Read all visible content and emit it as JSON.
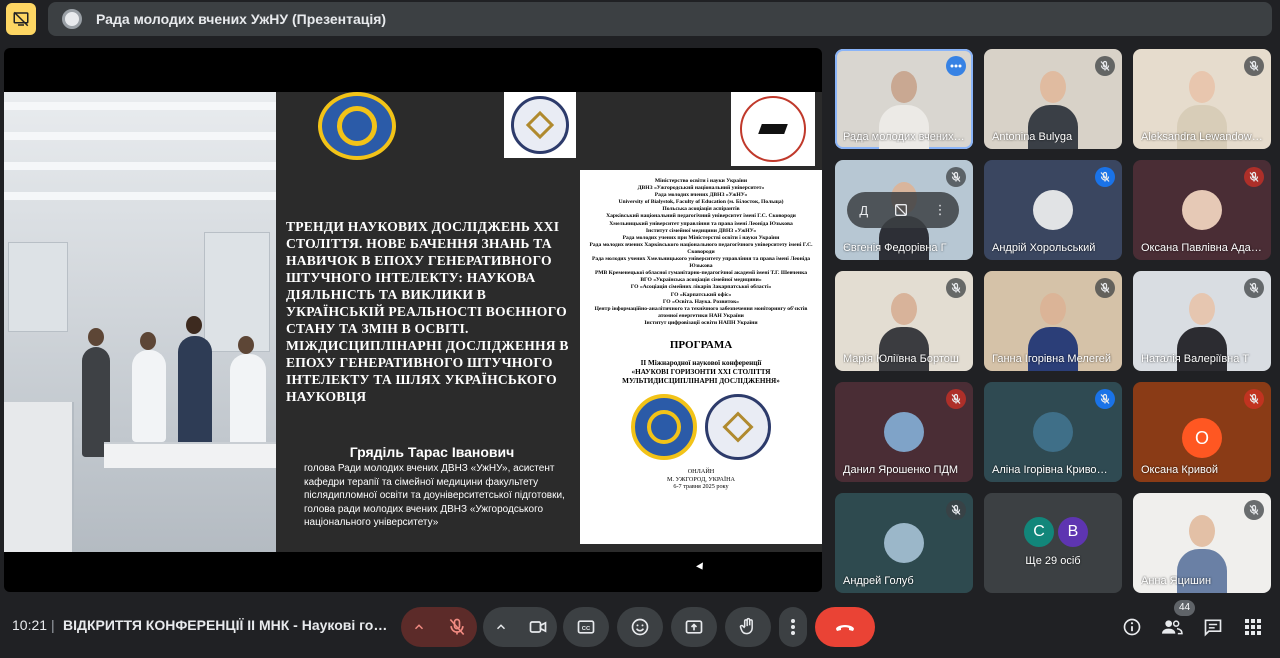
{
  "topbar": {
    "title": "Рада молодих вчених УжНУ (Презентація)"
  },
  "slide": {
    "title": "ТРЕНДИ НАУКОВИХ  ДОСЛІДЖЕНЬ XXI СТОЛІТТЯ. НОВЕ БАЧЕННЯ ЗНАНЬ ТА НАВИЧОК В ЕПОХУ ГЕНЕРАТИВНОГО ШТУЧНОГО ІНТЕЛЕКТУ: НАУКОВА ДІЯЛЬНІСТЬ ТА ВИКЛИКИ В УКРАЇНСЬКІЙ РЕАЛЬНОСТІ ВОЄННОГО СТАНУ ТА ЗМІН В ОСВІТІ. МІЖДИСЦИПЛІНАРНІ ДОСЛІДЖЕННЯ В ЕПОХУ ГЕНЕРАТИВНОГО ШТУЧНОГО ІНТЕЛЕКТУ ТА ШЛЯХ УКРАЇНСЬКОГО НАУКОВЦЯ",
    "speaker_name": "Гряділь Тарас Іванович",
    "speaker_desc": "голова Ради молодих вчених ДВНЗ «УжНУ», асистент кафедри терапії та сімейної медицини факультету післядипломної освіти та доуніверситетської підготовки, голова ради молодих вчених ДВНЗ «Ужгородського національного університету»",
    "program": {
      "orgs": [
        "Міністерство освіти і науки України",
        "ДВНЗ «Ужгородський національний університет»",
        "Рада молодих вчених ДВНЗ «УжНУ»",
        "University of Bialystok, Faculty of Education (м. Білосток, Польща)",
        "Польська асоціація аспірантів",
        "Харківський національний педагогічний університет імені Г.С. Сковороди",
        "Хмельницький університет управління та права імені Леоніда Юзькова",
        "Інститут сімейної медицини ДВНЗ «УжНУ»",
        "Рада молодих учених при Міністерстві освіти і науки України",
        "Рада молодих вчених Харківського національного педагогічного університету імені Г.С. Сковороди",
        "Рада молодих учених Хмельницького університету управління та права імені Леоніда Юзькова",
        "РМВ Кременецької обласної гуманітарно-педагогічної академії імені Т.Г. Шевченка",
        "ВГО «Українська асоціація сімейної медицини»",
        "ГО «Асоціація сімейних лікарів Закарпатської області»",
        "ГО «Карпатський офіс»",
        "ГО «Освіта. Наука. Розвиток»",
        "Центр інформаційно-аналітичного та технічного забезпечення моніторингу об'єктів атомної енергетики НАН України",
        "Інститут цифровізації освіти НАПН України"
      ],
      "heading": "ПРОГРАМА",
      "conf": [
        "ІІ Міжнародної наукової конференції",
        "«НАУКОВІ ГОРИЗОНТИ XXI СТОЛІТТЯ",
        "МУЛЬТИДИСЦИПЛІНАРНІ ДОСЛІДЖЕННЯ»"
      ],
      "footer": [
        "ОНЛАЙН",
        "М. УЖГОРОД, УКРАЇНА",
        "6-7 травня 2025 року"
      ]
    }
  },
  "participants": [
    {
      "name": "Рада молодих вчених УжНУ",
      "mic": "more",
      "skin": "#c9a892",
      "bg": "#d9d6d0",
      "shirt": "#eceae6"
    },
    {
      "name": "Antonina Bulyga",
      "mic": "muted",
      "skin": "#e0bba0",
      "bg": "#d8d2c8",
      "shirt": "#3a3f46"
    },
    {
      "name": "Aleksandra Lewandowska",
      "mic": "muted",
      "skin": "#e8c6ae",
      "bg": "#e6dccd",
      "shirt": "#d8cdb8"
    },
    {
      "name": "Євгенія Федорівна Г",
      "mic": "muted",
      "skin": "#d9b59c",
      "bg": "#b7c7d3",
      "shirt": "#2d2f36"
    },
    {
      "name": "Андрій Хорольський",
      "mic": "muted-blue",
      "avatar": "#e1e3e5"
    },
    {
      "name": "Оксана Павлівна Адамович",
      "mic": "muted-red",
      "avatar": "#e6c9b6"
    },
    {
      "name": "Марія Юліївна Бортош",
      "mic": "muted",
      "skin": "#d8b39a",
      "bg": "#e3ddd2",
      "shirt": "#3b3c40"
    },
    {
      "name": "Ганна Ігорівна Мелегей",
      "mic": "muted",
      "skin": "#dbb497",
      "bg": "#d5c2a8",
      "shirt": "#2b3e78"
    },
    {
      "name": "Наталія Валеріївна Т",
      "mic": "muted",
      "skin": "#e6c6b0",
      "bg": "#d9dde2",
      "shirt": "#2c2c31"
    },
    {
      "name": "Данил Ярошенко ПДМ",
      "mic": "muted-red",
      "avatar": "#7fa3c8"
    },
    {
      "name": "Аліна Ігорівна Кривошеїна",
      "mic": "muted-blue",
      "avatar": "#3f6f88"
    },
    {
      "name": "Оксана Кривой",
      "mic": "muted-red",
      "letter": "О"
    },
    {
      "name": "Андрей Голуб",
      "mic": "muted",
      "avatar": "#9bb7c9"
    },
    {
      "name": "Ще 29 осіб",
      "avatars": [
        "C",
        "B"
      ]
    },
    {
      "name": "Анна Яцишин",
      "mic": "muted",
      "skin": "#e3c0a6",
      "bg": "#f0efed",
      "shirt": "#6a80a5"
    }
  ],
  "tile_overlay": {
    "label": "Д",
    "more": "⋮"
  },
  "bottombar": {
    "time": "10:21",
    "separator": "|",
    "meeting": "ВІДКРИТТЯ КОНФЕРЕНЦІЇ ІІ МНК - Наукові горизонти XXI століття",
    "participants_count": "44",
    "colors": {
      "hangup": "#ea4335",
      "mic_off": "#f28b82"
    }
  }
}
